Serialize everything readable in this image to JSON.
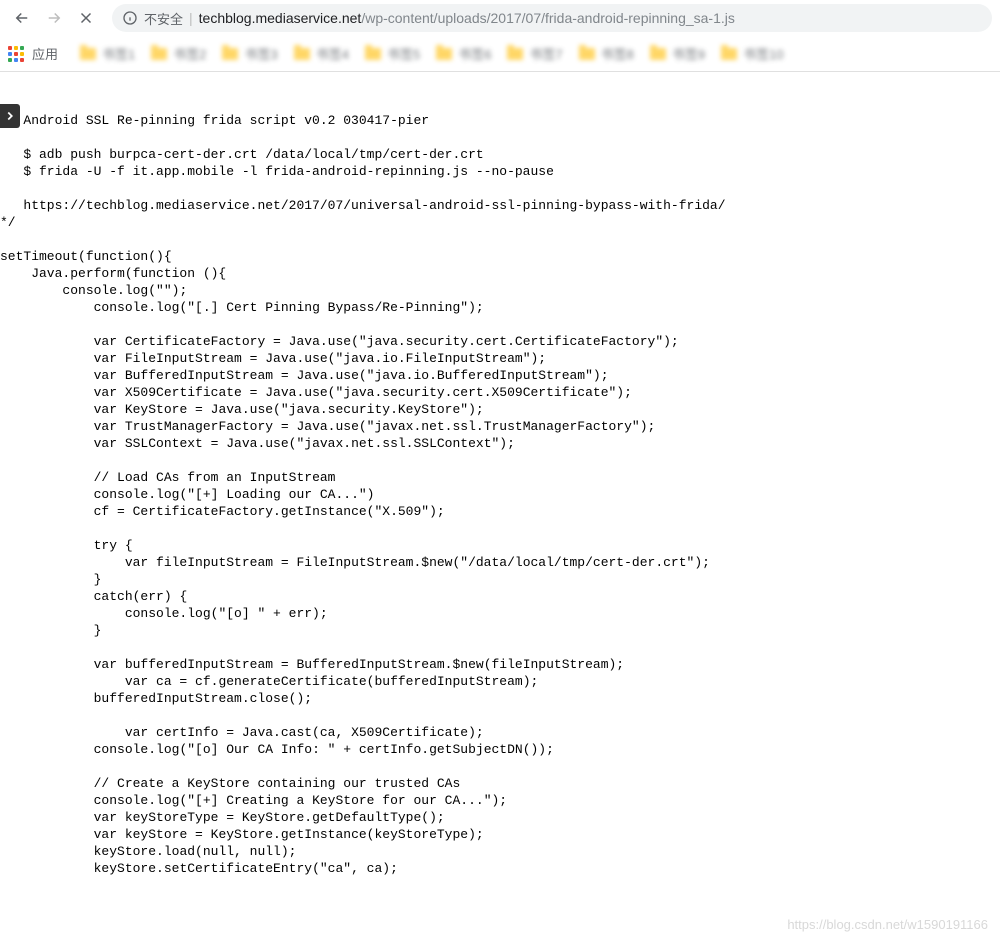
{
  "toolbar": {
    "insecure_label": "不安全",
    "url_domain": "techblog.mediaservice.net",
    "url_path": "/wp-content/uploads/2017/07/frida-android-repinning_sa-1.js"
  },
  "bookmarks": {
    "apps_label": "应用",
    "items": [
      "书签1",
      "书签2",
      "书签3",
      "书签4",
      "书签5",
      "书签6",
      "书签7",
      "书签8",
      "书签9",
      "书签10"
    ]
  },
  "code_text": "   Android SSL Re-pinning frida script v0.2 030417-pier\n\n   $ adb push burpca-cert-der.crt /data/local/tmp/cert-der.crt\n   $ frida -U -f it.app.mobile -l frida-android-repinning.js --no-pause\n\n   https://techblog.mediaservice.net/2017/07/universal-android-ssl-pinning-bypass-with-frida/\n*/\n\nsetTimeout(function(){\n    Java.perform(function (){\n    \tconsole.log(\"\");\n\t    console.log(\"[.] Cert Pinning Bypass/Re-Pinning\");\n\n\t    var CertificateFactory = Java.use(\"java.security.cert.CertificateFactory\");\n\t    var FileInputStream = Java.use(\"java.io.FileInputStream\");\n\t    var BufferedInputStream = Java.use(\"java.io.BufferedInputStream\");\n\t    var X509Certificate = Java.use(\"java.security.cert.X509Certificate\");\n\t    var KeyStore = Java.use(\"java.security.KeyStore\");\n\t    var TrustManagerFactory = Java.use(\"javax.net.ssl.TrustManagerFactory\");\n\t    var SSLContext = Java.use(\"javax.net.ssl.SSLContext\");\n\n\t    // Load CAs from an InputStream\n\t    console.log(\"[+] Loading our CA...\")\n\t    cf = CertificateFactory.getInstance(\"X.509\");\n\t    \n\t    try {\n\t    \tvar fileInputStream = FileInputStream.$new(\"/data/local/tmp/cert-der.crt\");\n\t    }\n\t    catch(err) {\n\t    \tconsole.log(\"[o] \" + err);\n\t    }\n\t    \n\t    var bufferedInputStream = BufferedInputStream.$new(fileInputStream);\n\t  \tvar ca = cf.generateCertificate(bufferedInputStream);\n\t    bufferedInputStream.close();\n\n\t\tvar certInfo = Java.cast(ca, X509Certificate);\n\t    console.log(\"[o] Our CA Info: \" + certInfo.getSubjectDN());\n\n\t    // Create a KeyStore containing our trusted CAs\n\t    console.log(\"[+] Creating a KeyStore for our CA...\");\n\t    var keyStoreType = KeyStore.getDefaultType();\n\t    var keyStore = KeyStore.getInstance(keyStoreType);\n\t    keyStore.load(null, null);\n\t    keyStore.setCertificateEntry(\"ca\", ca);",
  "watermark": "https://blog.csdn.net/w1590191166"
}
